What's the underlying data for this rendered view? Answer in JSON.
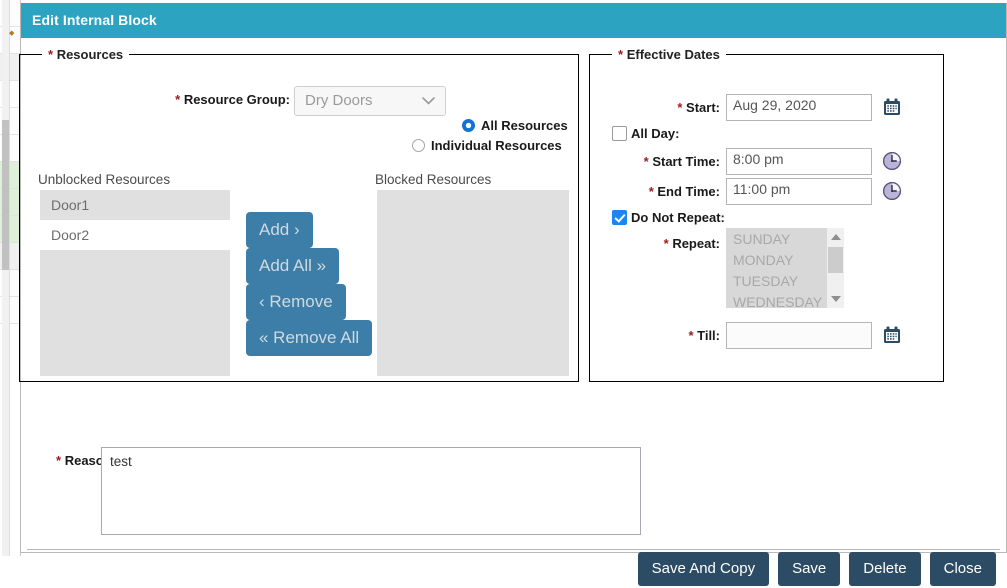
{
  "window": {
    "title": "Edit Internal Block"
  },
  "resources_panel": {
    "legend": "Resources",
    "legend_required": "*",
    "resource_group": {
      "label": "Resource Group:",
      "label_required": "*",
      "value": "Dry Doors",
      "caret": "⌄",
      "disabled": true
    },
    "scope_options": [
      {
        "label": "All Resources",
        "selected": true
      },
      {
        "label": "Individual Resources",
        "selected": false
      }
    ],
    "unblocked": {
      "caption": "Unblocked Resources",
      "items": [
        "Door1",
        "Door2"
      ]
    },
    "blocked": {
      "caption": "Blocked Resources",
      "items": []
    },
    "transfer_buttons": [
      {
        "key": "add",
        "label": "Add ›"
      },
      {
        "key": "add_all",
        "label": "Add All »"
      },
      {
        "key": "remove",
        "label": "‹ Remove"
      },
      {
        "key": "remove_all",
        "label": "« Remove All"
      }
    ]
  },
  "dates_panel": {
    "legend": "Effective Dates",
    "legend_required": "*",
    "start": {
      "label": "Start:",
      "label_required": "*",
      "value": "Aug 29, 2020",
      "icon": "calendar-icon"
    },
    "all_day": {
      "label": "All Day:",
      "checked": false
    },
    "start_time": {
      "label": "Start Time:",
      "label_required": "*",
      "value": "8:00 pm",
      "icon": "clock-icon"
    },
    "end_time": {
      "label": "End Time:",
      "label_required": "*",
      "value": "11:00 pm",
      "icon": "clock-icon"
    },
    "do_not_repeat": {
      "label": "Do Not Repeat:",
      "checked": true
    },
    "repeat": {
      "label": "Repeat:",
      "label_required": "*",
      "disabled": true,
      "options": [
        "SUNDAY",
        "MONDAY",
        "TUESDAY",
        "WEDNESDAY"
      ]
    },
    "till": {
      "label": "Till:",
      "label_required": "*",
      "value": "",
      "icon": "calendar-icon"
    }
  },
  "reason": {
    "label": "Reason:",
    "label_required": "*",
    "value": "test"
  },
  "footer": {
    "buttons": [
      {
        "key": "save_and_copy",
        "label": "Save And Copy"
      },
      {
        "key": "save",
        "label": "Save"
      },
      {
        "key": "delete",
        "label": "Delete"
      },
      {
        "key": "close",
        "label": "Close"
      }
    ]
  },
  "colors": {
    "titlebar": "#2ba3c1",
    "transfer_button": "#3c7ea8",
    "footer_button": "#2c4b64",
    "required_marker": "#9b1b1b",
    "checkbox_on": "#1a86ef",
    "radio_on": "#1273d4"
  }
}
